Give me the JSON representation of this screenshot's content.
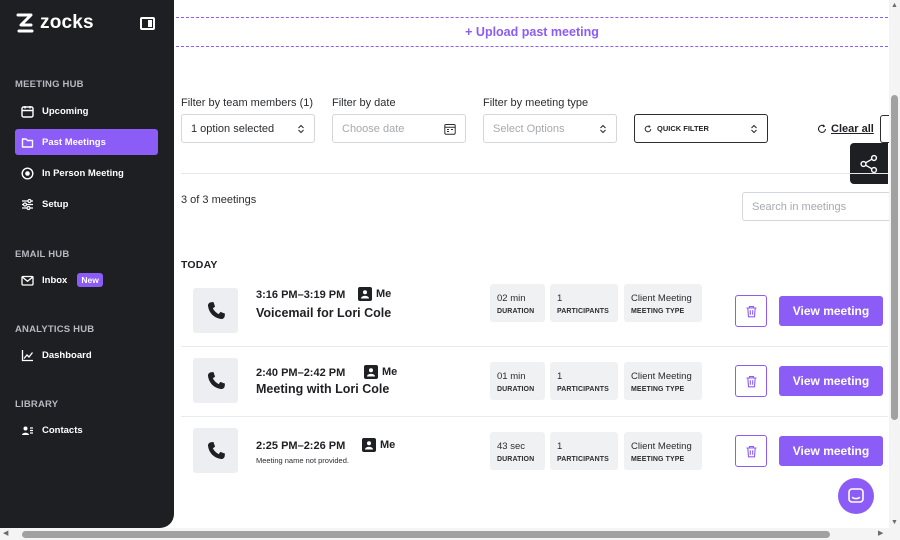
{
  "app": {
    "name": "zocks"
  },
  "sidebar": {
    "sections": [
      {
        "title": "MEETING HUB",
        "items": [
          {
            "label": "Upcoming",
            "icon": "calendar-icon"
          },
          {
            "label": "Past Meetings",
            "icon": "folder-icon",
            "active": true
          },
          {
            "label": "In Person Meeting",
            "icon": "record-icon"
          },
          {
            "label": "Setup",
            "icon": "sliders-icon"
          }
        ]
      },
      {
        "title": "EMAIL HUB",
        "items": [
          {
            "label": "Inbox",
            "icon": "mail-icon",
            "badge": "New"
          }
        ]
      },
      {
        "title": "ANALYTICS HUB",
        "items": [
          {
            "label": "Dashboard",
            "icon": "line-chart-icon"
          }
        ]
      },
      {
        "title": "LIBRARY",
        "items": [
          {
            "label": "Contacts",
            "icon": "contacts-icon"
          }
        ]
      }
    ]
  },
  "upload": {
    "label": "+ Upload past meeting"
  },
  "filters": {
    "team": {
      "label": "Filter by team members (1)",
      "value": "1 option selected"
    },
    "date": {
      "label": "Filter by date",
      "placeholder": "Choose date"
    },
    "type": {
      "label": "Filter by meeting type",
      "placeholder": "Select Options"
    },
    "quick": {
      "value": "QUICK FILTER"
    },
    "clear": "Clear all"
  },
  "list": {
    "count": "3 of 3 meetings",
    "search_placeholder": "Search in meetings",
    "group": "TODAY",
    "meetings": [
      {
        "time": "3:16 PM–3:19 PM",
        "owner": "Me",
        "title": "Voicemail for Lori Cole",
        "subtitle": "",
        "duration": "02 min",
        "duration_label": "DURATION",
        "participants": "1",
        "participants_label": "PARTICIPANTS",
        "type": "Client Meeting",
        "type_label": "MEETING TYPE",
        "action": "View meeting"
      },
      {
        "time": "2:40 PM–2:42 PM",
        "owner": "Me",
        "title": "Meeting with Lori Cole",
        "subtitle": "",
        "duration": "01 min",
        "duration_label": "DURATION",
        "participants": "1",
        "participants_label": "PARTICIPANTS",
        "type": "Client Meeting",
        "type_label": "MEETING TYPE",
        "action": "View meeting"
      },
      {
        "time": "2:25 PM–2:26 PM",
        "owner": "Me",
        "title": "",
        "subtitle": "Meeting name not provided.",
        "duration": "43 sec",
        "duration_label": "DURATION",
        "participants": "1",
        "participants_label": "PARTICIPANTS",
        "type": "Client Meeting",
        "type_label": "MEETING TYPE",
        "action": "View meeting"
      }
    ]
  },
  "colors": {
    "accent": "#8b5cf6",
    "sidebar": "#1d1f22"
  }
}
